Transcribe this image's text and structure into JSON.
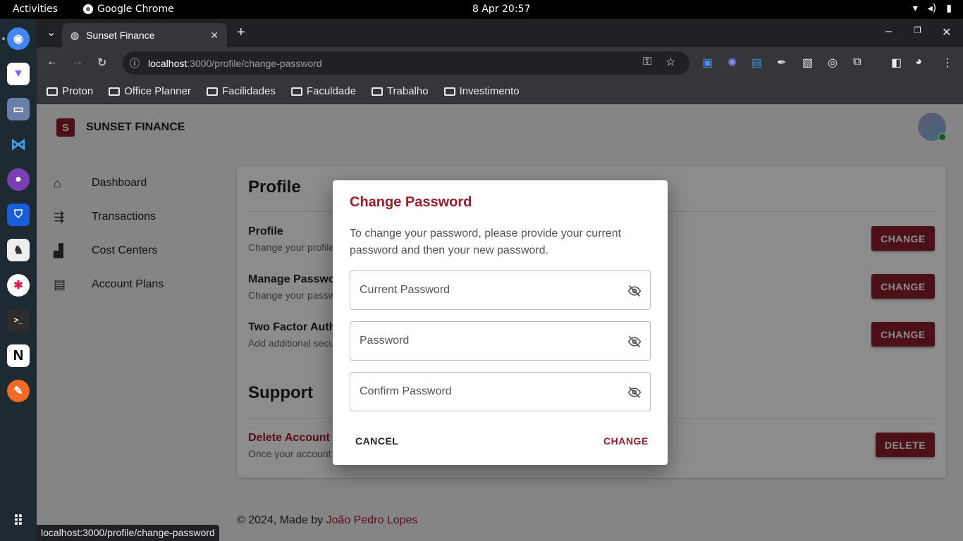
{
  "topbar": {
    "activities": "Activities",
    "app_name": "Google Chrome",
    "clock": "8 Apr  20:57"
  },
  "browser": {
    "tab_title": "Sunset Finance",
    "url_host": "localhost",
    "url_path": ":3000/profile/change-password",
    "bookmarks": [
      "Proton",
      "Office Planner",
      "Facilidades",
      "Faculdade",
      "Trabalho",
      "Investimento"
    ],
    "status_url": "localhost:3000/profile/change-password"
  },
  "app": {
    "brand": "SUNSET FINANCE",
    "logo_letter": "S",
    "nav": [
      "Dashboard",
      "Transactions",
      "Cost Centers",
      "Account Plans"
    ],
    "profile_heading": "Profile",
    "rows": [
      {
        "title": "Profile",
        "subtitle": "Change your profile",
        "button": "CHANGE"
      },
      {
        "title": "Manage Passwo",
        "subtitle": "Change your passw",
        "button": "CHANGE"
      },
      {
        "title": "Two Factor Auth",
        "subtitle": "Add additional secu",
        "button": "CHANGE"
      }
    ],
    "support_heading": "Support",
    "delete": {
      "title": "Delete Account",
      "subtitle": "Once your account",
      "button": "DELETE"
    },
    "footer_prefix": "© 2024, Made by ",
    "footer_author": "João Pedro Lopes"
  },
  "dialog": {
    "title": "Change Password",
    "description": "To change your password, please provide your current password and then your new password.",
    "fields": [
      "Current Password",
      "Password",
      "Confirm Password"
    ],
    "cancel": "CANCEL",
    "confirm": "CHANGE"
  },
  "colors": {
    "accent": "#8b1e2c",
    "accent_text": "#a01c2b"
  }
}
